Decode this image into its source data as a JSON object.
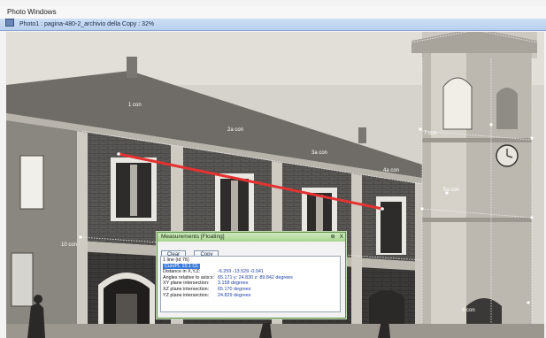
{
  "window": {
    "title": "Photo Windows",
    "tab_label": "Photo1 : pagina-480-2_archivio della Copy : 32%"
  },
  "dialog": {
    "title": "Measurements [Floating]",
    "pin": "⊕",
    "close": "X",
    "clear_label": "Clear",
    "copy_label": "Copy",
    "rows": [
      {
        "label": "1 line (id 76)",
        "value": ""
      },
      {
        "label": "CurvPL",
        "value": "15.1 CL"
      },
      {
        "label": "Distance in X,Y,Z:",
        "value": "-6.259   -13.529   -0.041"
      },
      {
        "label": "Angles relative to axis:x:",
        "value": "65.171 y:   24.830 z:   89.842 degrees"
      },
      {
        "label": "XY plane intersection:",
        "value": "3.158 degrees"
      },
      {
        "label": "XZ plane intersection:",
        "value": "65.170 degrees"
      },
      {
        "label": "YZ plane intersection:",
        "value": "24.829 degrees"
      }
    ]
  },
  "photo": {
    "measure_line_color": "#e23232",
    "labels": [
      "1 con",
      "2a con",
      "3a con",
      "4a con",
      "5a con",
      "10 con",
      "6 con",
      "7 con"
    ]
  },
  "colors": {
    "tab_bg": "#c2d5f0",
    "dialog_title_bg": "#b9df9f",
    "selection": "#3d7bd9"
  }
}
